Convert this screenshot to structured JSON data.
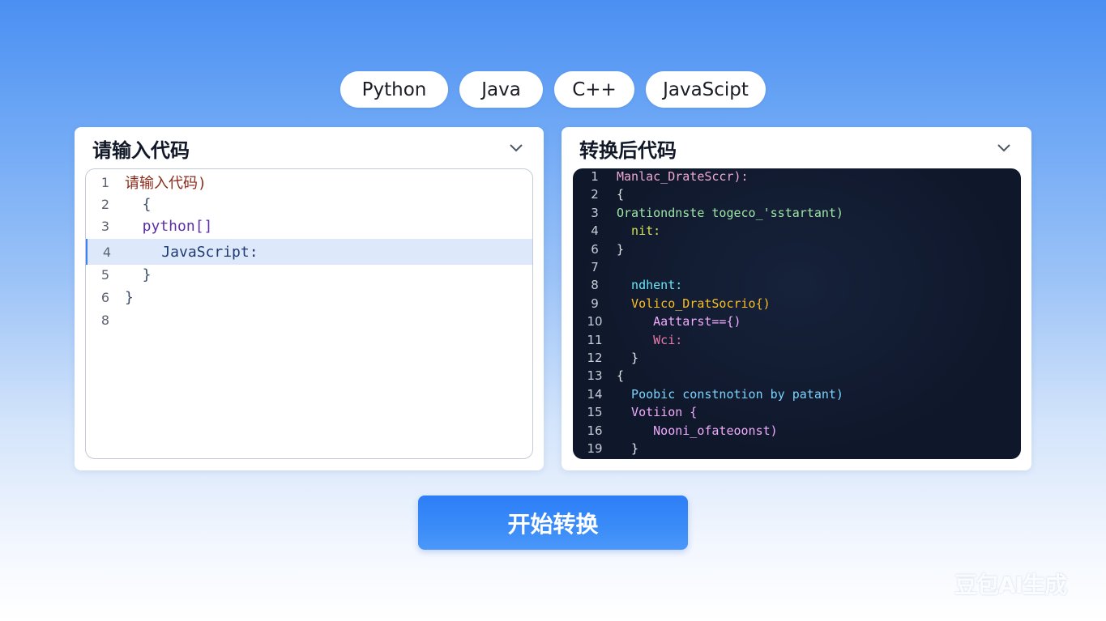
{
  "language_tabs": [
    "Python",
    "Java",
    "C++",
    "JavaScipt"
  ],
  "input_panel": {
    "title": "请输入代码",
    "lines": [
      {
        "n": "1",
        "code": "请输入代码)",
        "color": "#8b2a1a"
      },
      {
        "n": "2",
        "code": "  {",
        "color": "#3a4b6b"
      },
      {
        "n": "3",
        "code": "  python[]",
        "color": "#5b2fa8"
      },
      {
        "n": "4",
        "code": "    JavaScript:",
        "color": "#1f3a73"
      },
      {
        "n": "5",
        "code": "  }",
        "color": "#3a4b6b"
      },
      {
        "n": "6",
        "code": "}",
        "color": "#3a4b6b"
      },
      {
        "n": "8",
        "code": "",
        "color": "#3a4b6b"
      }
    ],
    "active_line": "4"
  },
  "output_panel": {
    "title": "转换后代码",
    "lines": [
      {
        "n": "1",
        "code": "Manlac_DrateSccr):",
        "color": "#f0a8d0"
      },
      {
        "n": "2",
        "code": "{",
        "color": "#e5e7eb"
      },
      {
        "n": "3",
        "code": "Orationdnste togeco_'sstartant)",
        "color": "#9ee6a6"
      },
      {
        "n": "4",
        "code": "  nit:",
        "color": "#d4e157"
      },
      {
        "n": "6",
        "code": "}",
        "color": "#e5e7eb"
      },
      {
        "n": "7",
        "code": "",
        "color": "#e5e7eb"
      },
      {
        "n": "8",
        "code": "  ndhent:",
        "color": "#67e8f9"
      },
      {
        "n": "9",
        "code": "  Volico_DratSocrio{)",
        "color": "#fbbf24"
      },
      {
        "n": "10",
        "code": "     Aattarst=={)",
        "color": "#f0abfc"
      },
      {
        "n": "11",
        "code": "     Wci:",
        "color": "#e879a8"
      },
      {
        "n": "12",
        "code": "  }",
        "color": "#e5e7eb"
      },
      {
        "n": "13",
        "code": "{",
        "color": "#e5e7eb"
      },
      {
        "n": "14",
        "code": "  Poobic constnotion by patant)",
        "color": "#7dd3fc"
      },
      {
        "n": "15",
        "code": "  Votiion {",
        "color": "#f0abfc"
      },
      {
        "n": "16",
        "code": "     Nooni_ofateoonst)",
        "color": "#f0abfc"
      },
      {
        "n": "19",
        "code": "  }",
        "color": "#e5e7eb"
      }
    ]
  },
  "convert_button": "开始转换",
  "watermark": "豆包AI生成",
  "icons": {
    "dropdown": "chevron-down-icon"
  }
}
